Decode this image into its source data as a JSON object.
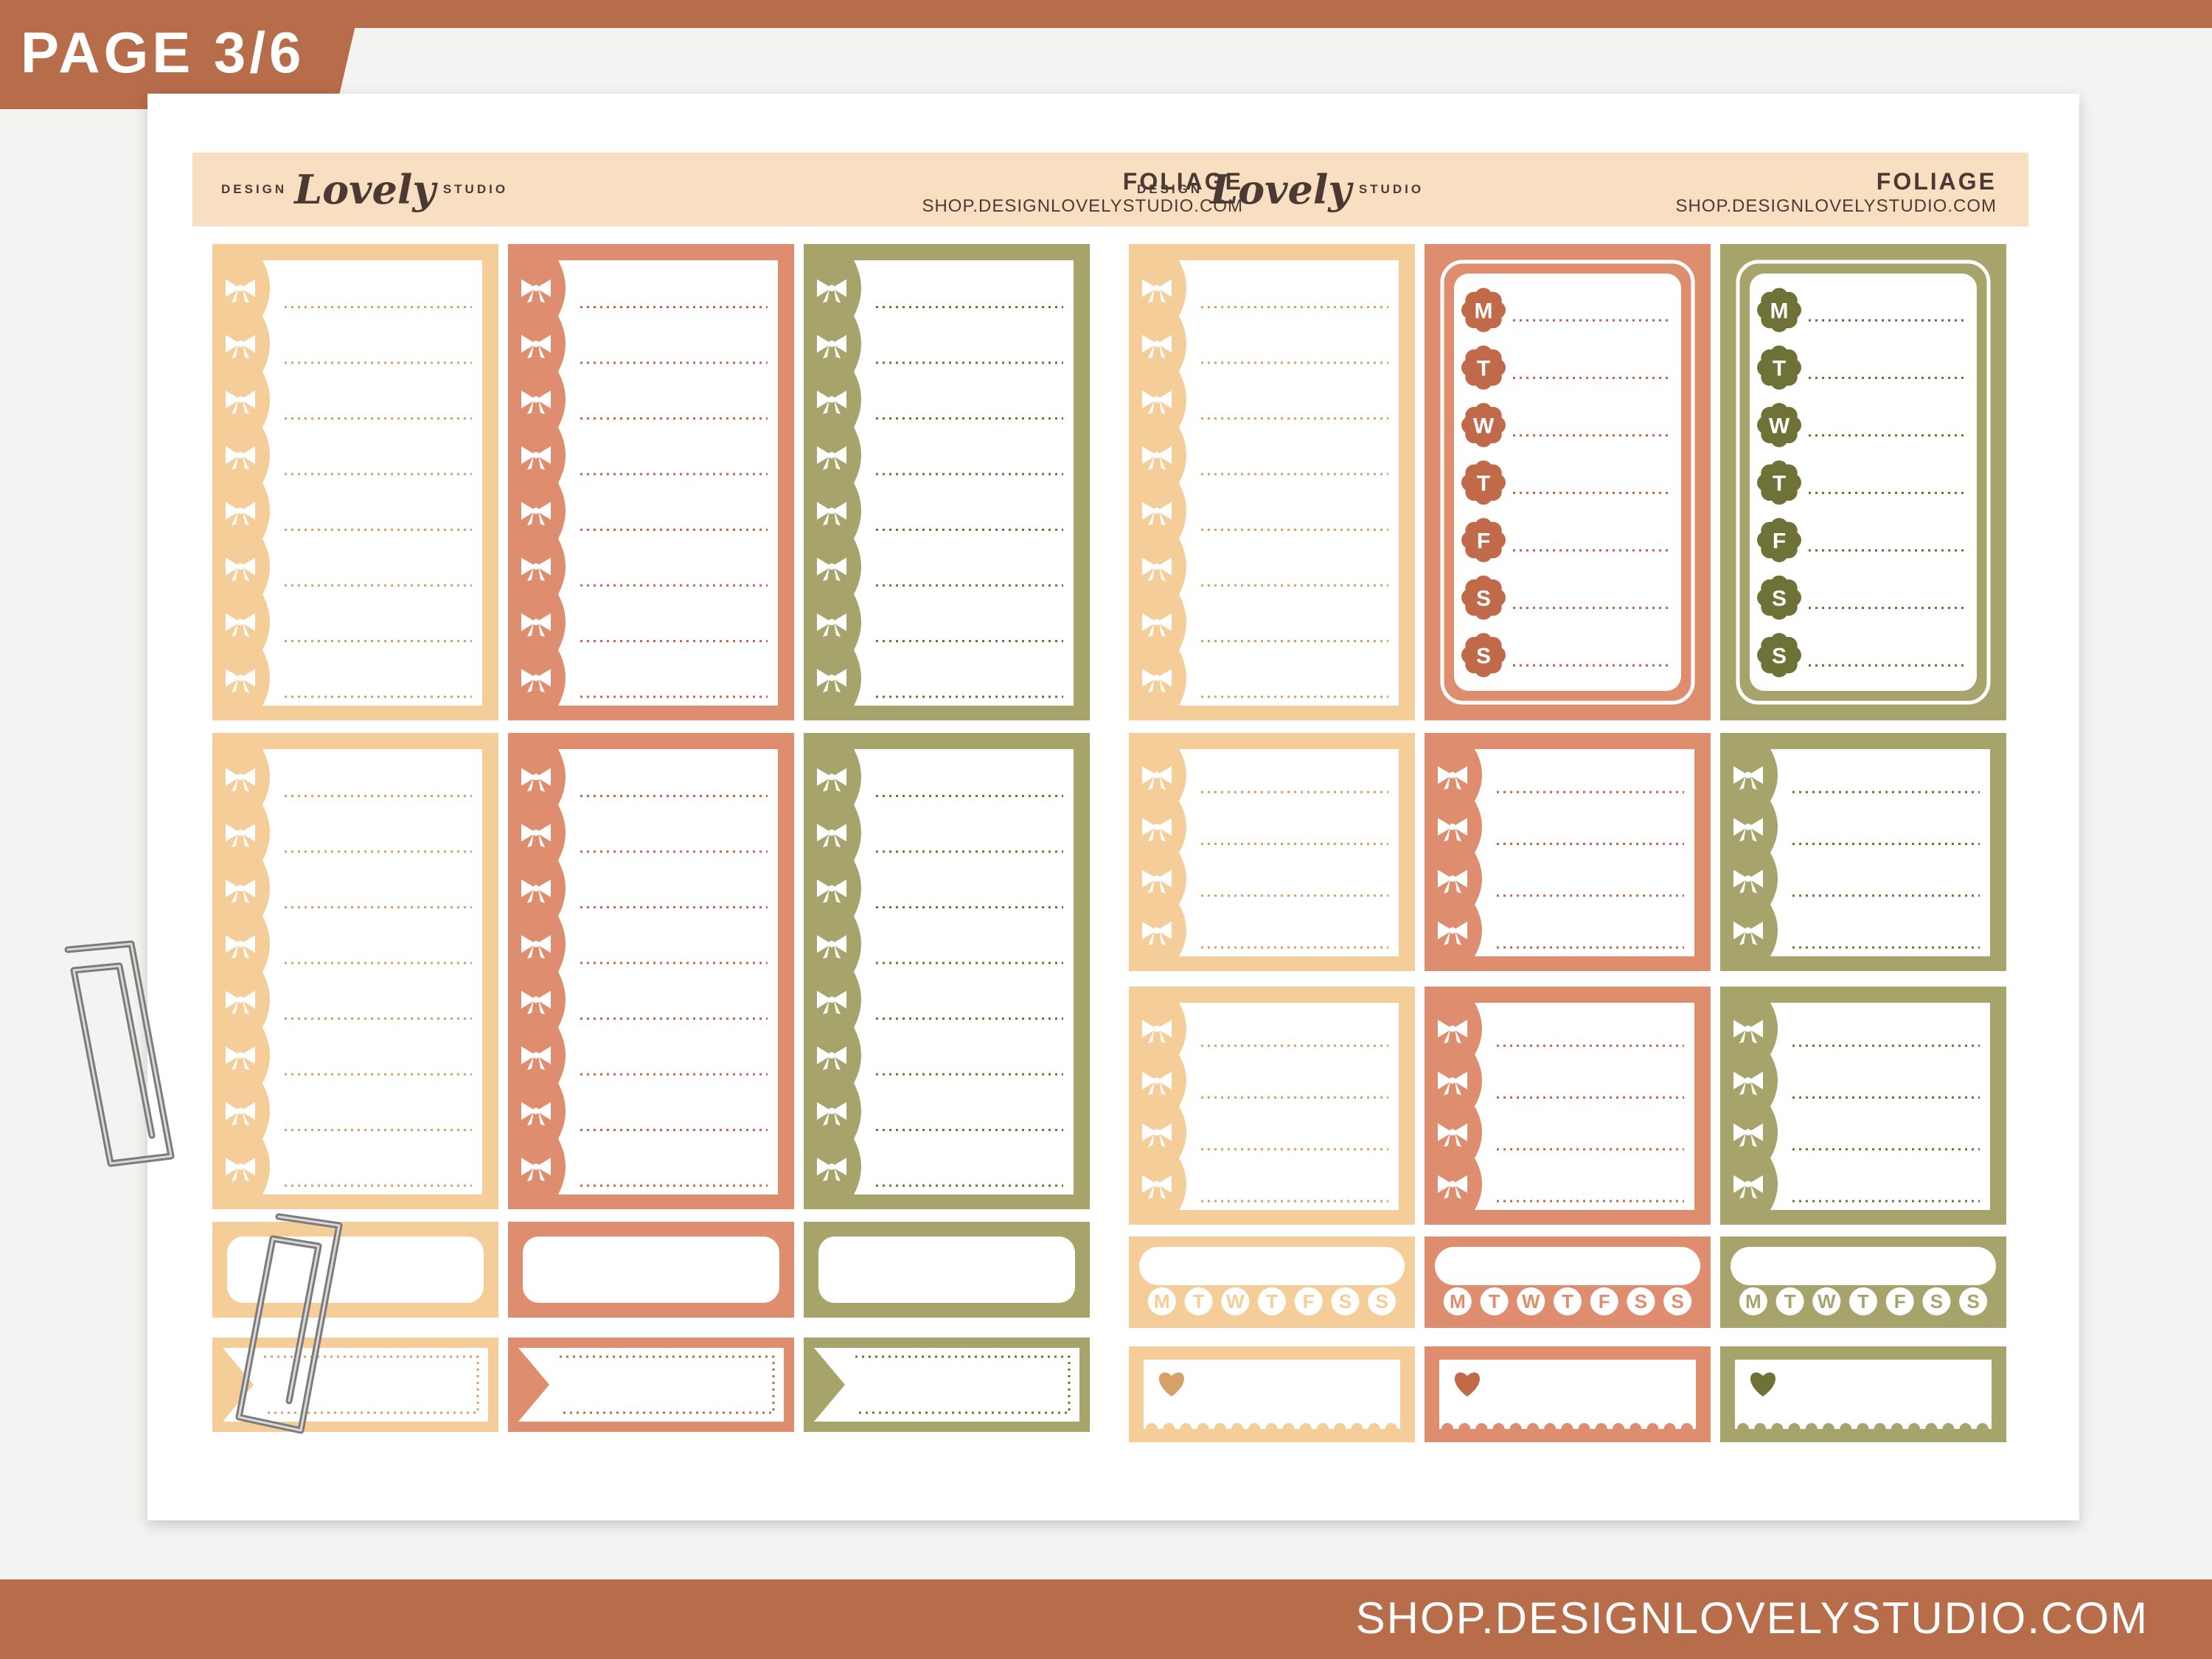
{
  "page_label": "PAGE 3/6",
  "footer_url": "SHOP.DESIGNLOVELYSTUDIO.COM",
  "headers": [
    {
      "brand_left": "DESIGN",
      "brand_script": "Lovely",
      "brand_right": "STUDIO",
      "title": "FOLIAGE",
      "url": "SHOP.DESIGNLOVELYSTUDIO.COM"
    },
    {
      "brand_left": "DESIGN",
      "brand_script": "Lovely",
      "brand_right": "STUDIO",
      "title": "FOLIAGE",
      "url": "SHOP.DESIGNLOVELYSTUDIO.COM"
    }
  ],
  "weekdays": [
    "M",
    "T",
    "W",
    "T",
    "F",
    "S",
    "S"
  ],
  "colors": {
    "peach": "#f5cd98",
    "terracotta": "#df8d6f",
    "olive": "#a6a46b",
    "peach_line": "#d6a068",
    "terracotta_line": "#c06a4a",
    "olive_line": "#6f7236",
    "header_band": "#f8dfc1",
    "brand_bar": "#b86d4a"
  },
  "icons": [
    "bow-icon",
    "heart-icon",
    "scallop-day-badge",
    "paper-clip"
  ]
}
